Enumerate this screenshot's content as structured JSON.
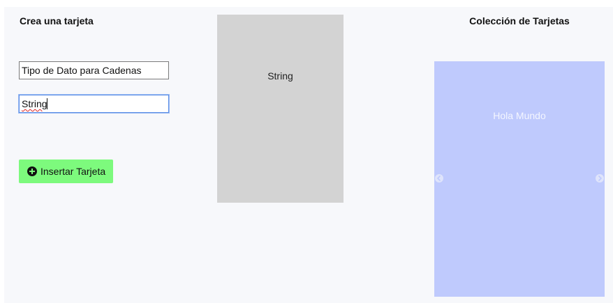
{
  "form": {
    "title": "Crea una tarjeta",
    "fields": [
      {
        "value": "Tipo de Dato para Cadenas"
      },
      {
        "value": "String"
      }
    ],
    "insert_button": {
      "label": "Insertar Tarjeta",
      "icon": "plus-circle-icon"
    }
  },
  "preview": {
    "text": "String"
  },
  "collection": {
    "title": "Colección de Tarjetas",
    "current_card_text": "Hola Mundo",
    "prev_icon": "arrow-left-circle-icon",
    "next_icon": "arrow-right-circle-icon"
  },
  "colors": {
    "insert_button": "#7dfa7d",
    "preview_card": "#d3d3d3",
    "carousel_card": "#bfcafd"
  }
}
